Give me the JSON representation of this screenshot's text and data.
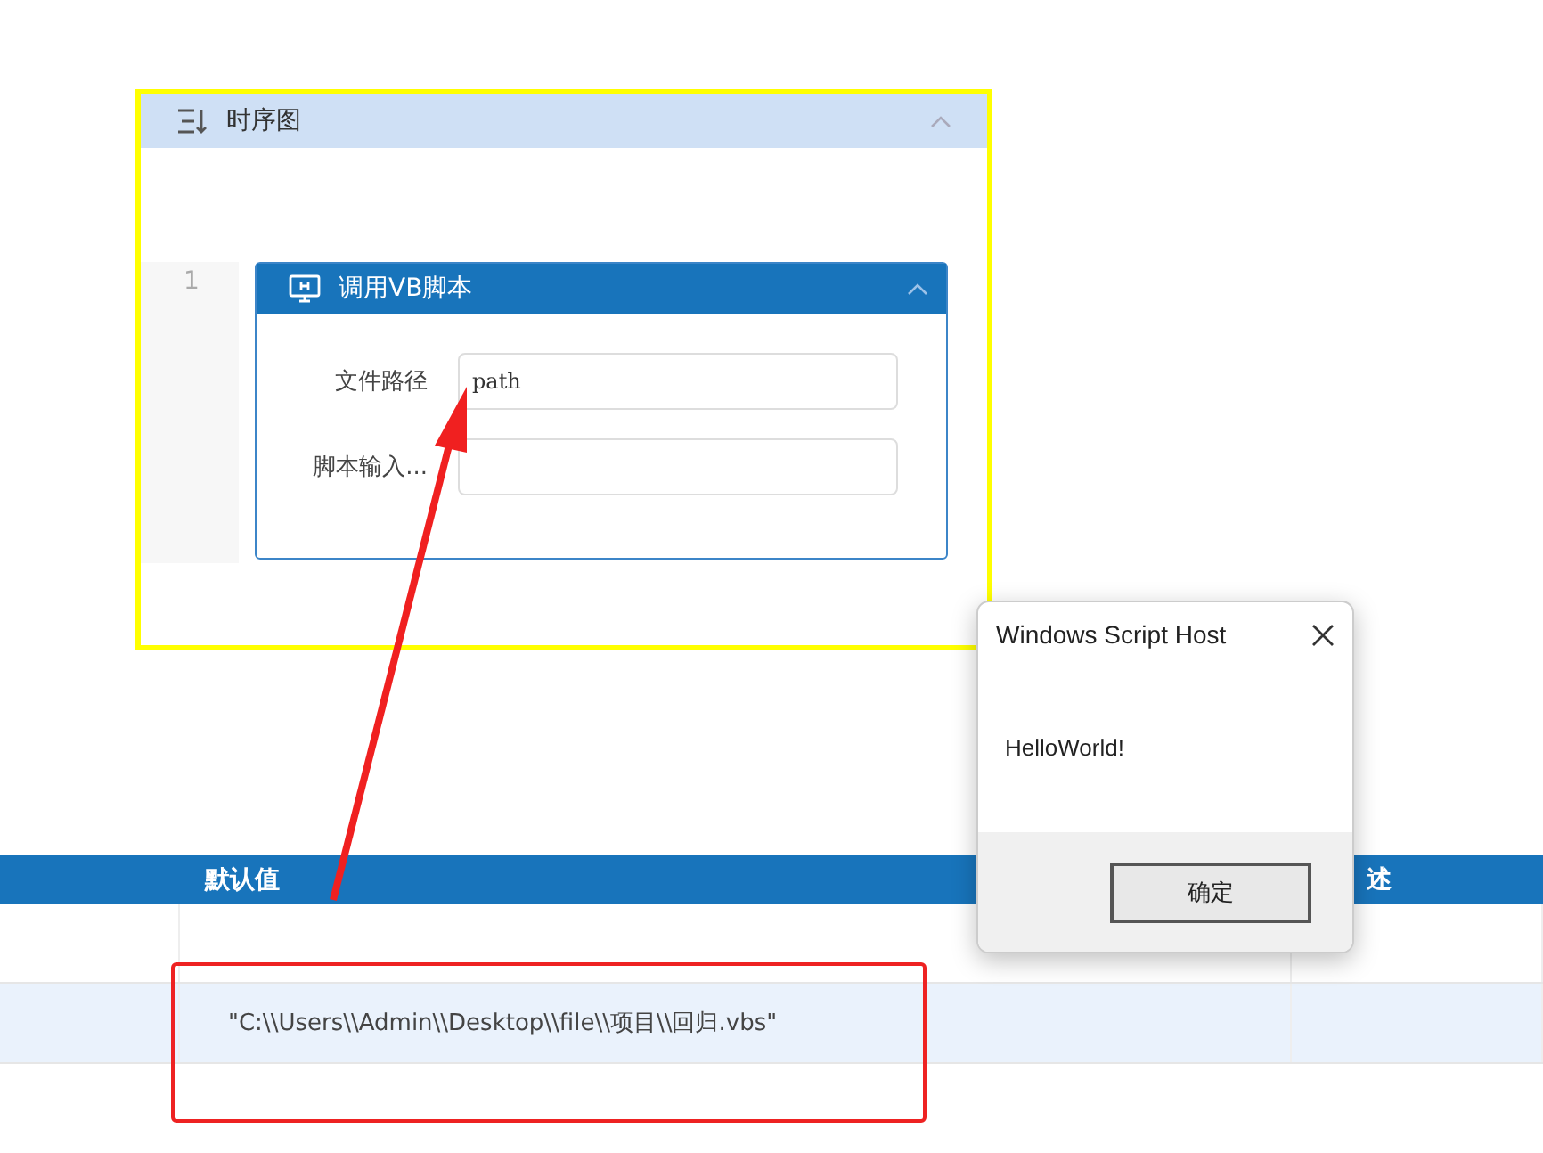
{
  "sequence_panel": {
    "title": "时序图",
    "steps": [
      {
        "number": "1",
        "title": "调用VB脚本",
        "fields": [
          {
            "label": "文件路径",
            "value": "path"
          },
          {
            "label": "脚本输入..."
          }
        ]
      }
    ]
  },
  "table": {
    "columns": [
      "默认值",
      "述"
    ],
    "rows": [
      {
        "selected": false
      },
      {
        "value": "\"C:\\\\Users\\\\Admin\\\\Desktop\\\\file\\\\项目\\\\回归.vbs\"",
        "selected": true
      }
    ]
  },
  "dialog": {
    "title": "Windows Script Host",
    "message": "HelloWorld!",
    "button": "确定"
  }
}
